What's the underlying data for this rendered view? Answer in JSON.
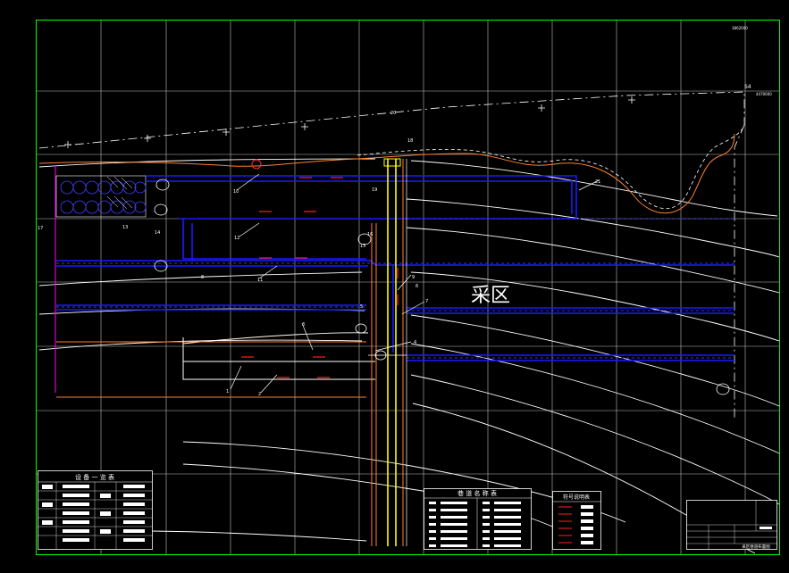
{
  "drawing": {
    "coord_top_right": "3862000",
    "coord_right": "4470000",
    "corner_label": "S4",
    "mining_area_label": "采区",
    "labels": {
      "n1": "1",
      "n2": "2",
      "n3": "3",
      "n4": "4",
      "n5": "5",
      "n6": "6",
      "n7": "7",
      "n8": "8",
      "n9": "9",
      "n10": "10",
      "n11": "11",
      "n12": "12",
      "n13": "13",
      "n14": "14",
      "n15": "15",
      "n16": "16",
      "n17": "17",
      "n18": "18",
      "n19": "19",
      "n20": "20",
      "n21": "21"
    }
  },
  "tables": {
    "equipment_title": "设 备 一 览 表",
    "tunnel_title": "巷 道 名 称 表",
    "symbol_title": "符号说明表",
    "title_block_caption": "采区巷道布置图"
  },
  "colors": {
    "background": "#000000",
    "frame": "#00ff00",
    "grid": "#ffffff",
    "tunnel": "#1a1aff",
    "arrow": "#ff2020",
    "shaft": "#ffff00",
    "outline": "#ff8030",
    "magenta": "#ff00ff"
  }
}
